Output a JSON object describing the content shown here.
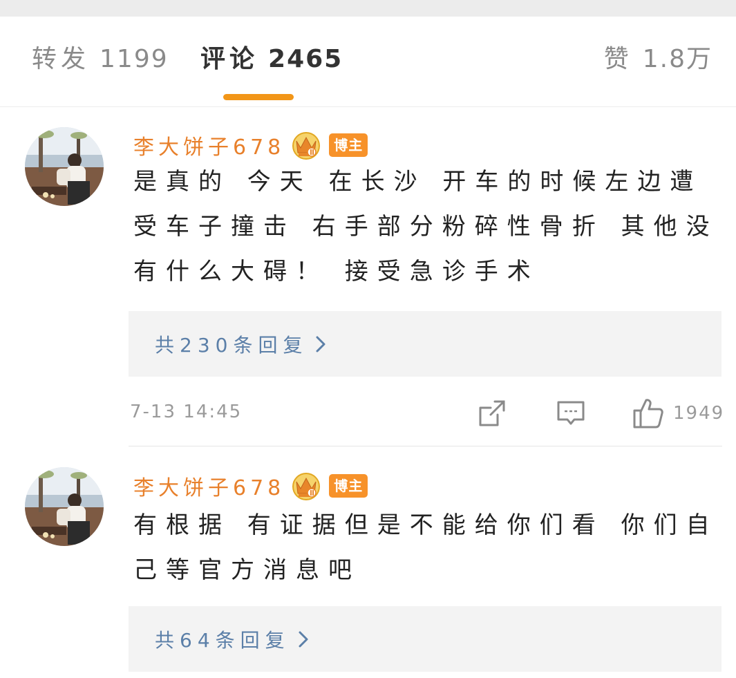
{
  "tabs": {
    "repost": {
      "label": "转发",
      "count": "1199"
    },
    "comment": {
      "label": "评论",
      "count": "2465"
    },
    "like": {
      "label": "赞",
      "count": "1.8万"
    },
    "active_color": "#f29618"
  },
  "comments": [
    {
      "username": "李大饼子678",
      "badge": "博主",
      "text": "是真的 今天 在长沙 开车的时候左边遭受车子撞击 右手部分粉碎性骨折 其他没有什么大碍！ 接受急诊手术",
      "replies_link": "共230条回复",
      "timestamp": "7-13 14:45",
      "like_count": "1949"
    },
    {
      "username": "李大饼子678",
      "badge": "博主",
      "text": "有根据 有证据但是不能给你们看 你们自己等官方消息吧",
      "replies_link": "共64条回复"
    }
  ],
  "icons": {
    "crown": "crown-vip-icon",
    "chevron": "chevron-right-icon",
    "share": "share-icon",
    "reply": "comment-icon",
    "like": "thumbs-up-icon"
  },
  "colors": {
    "username": "#e8802b",
    "badge": "#f7922a",
    "link": "#5b7fa8"
  }
}
